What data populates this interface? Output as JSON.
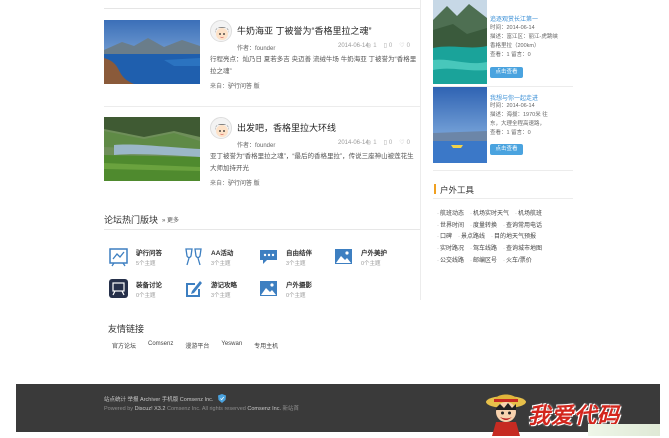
{
  "posts": [
    {
      "title": "牛奶海亚 丁被誉为“香格里拉之魂”",
      "author": "作者：founder",
      "date": "2014-06-14",
      "views": "1",
      "replies": "0",
      "likes": "0",
      "desc": "行程亮点：灿乃日 夏若多吉 央迈善 流绒牛场 牛奶海亚 丁被誉为“香格里拉之魂”",
      "from_label": "来自：",
      "from": "驴行问答 版"
    },
    {
      "title": "出发吧，香格里拉大环线",
      "author": "作者：founder",
      "date": "2014-06-14",
      "views": "1",
      "replies": "0",
      "likes": "0",
      "desc": "亚丁被誉为“香格里拉之魂”，“最后的香格里拉”，传说三座神山被莲花生大师加持开光",
      "from_label": "来自：",
      "from": "驴行问答 版"
    }
  ],
  "hot": {
    "title": "论坛热门版块",
    "more": "更多",
    "forums": [
      {
        "name": "驴行问答",
        "count": "5个主题",
        "icon": "map-board-icon"
      },
      {
        "name": "AA活动",
        "count": "3个主题",
        "icon": "cheers-icon"
      },
      {
        "name": "自由结伴",
        "count": "3个主题",
        "icon": "chat-icon"
      },
      {
        "name": "户外美护",
        "count": "0个主题",
        "icon": "image-icon"
      },
      {
        "name": "装备讨论",
        "count": "0个主题",
        "icon": "board-icon"
      },
      {
        "name": "游记攻略",
        "count": "3个主题",
        "icon": "edit-icon"
      },
      {
        "name": "户外摄影",
        "count": "0个主题",
        "icon": "photo-icon"
      }
    ]
  },
  "links": {
    "title": "友情链接",
    "items": [
      "官方论坛",
      "Comsenz",
      "漫游平台",
      "Yeswan",
      "专用主机"
    ]
  },
  "side_items": [
    {
      "title": "追逐观赏长江第一",
      "lines": [
        "时间：2014-06-14",
        "描述：富江区：丽江-虎跳峡",
        "香格里拉（200km）",
        "查看：1 留言：0"
      ],
      "button": "点击查看"
    },
    {
      "title": "我想与你一起走进",
      "lines": [
        "时间：2014-06-14",
        "描述：海拔：1970米 往",
        "东，大理全程高速路，",
        "查看：1 留言：0"
      ],
      "button": "点击查看"
    }
  ],
  "tools": {
    "title": "户外工具",
    "rows": [
      [
        "航班动态",
        "机场实时天气",
        "机场航班"
      ],
      [
        "世界时间",
        "度量转换",
        "查询常用电话"
      ],
      [
        "口碑",
        "景点路线",
        "目的地天气预报"
      ],
      [
        "实时路况",
        "驾车线路",
        "查询城市地图"
      ],
      [
        "公交线路",
        "邮编区号",
        "火车/票价"
      ]
    ]
  },
  "footer": {
    "line1": "站点统计 举报 Archiver 手机版 Comsenz Inc.",
    "powered_prefix": "Powered by ",
    "powered_brand": "Discuz! X3.2",
    "powered_mid": " Comsenz Inc. All rights reserved ",
    "powered_co": "Comsenz Inc.",
    "powered_suffix": " 新站首"
  },
  "watermark": "我爱代码",
  "colors": {
    "accent": "#4aa3df",
    "side_title": "#3a8fd6",
    "tools_bar": "#f0a020",
    "footer_bg": "#3a3a3a",
    "watermark": "#d3261d"
  }
}
